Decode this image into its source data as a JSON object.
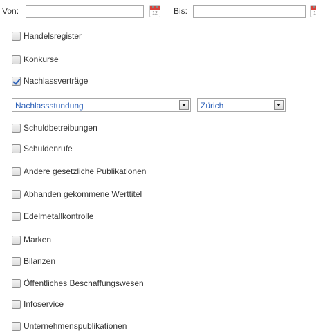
{
  "date_filter": {
    "from_label": "Von:",
    "from_value": "",
    "to_label": "Bis:",
    "to_value": "",
    "calendar_icon_text": "12"
  },
  "categories": [
    {
      "label": "Handelsregister",
      "checked": false
    },
    {
      "label": "Konkurse",
      "checked": false
    },
    {
      "label": "Nachlassverträge",
      "checked": true
    },
    {
      "label": "Schuldbetreibungen",
      "checked": false
    },
    {
      "label": "Schuldenrufe",
      "checked": false
    },
    {
      "label": "Andere gesetzliche Publikationen",
      "checked": false
    },
    {
      "label": "Abhanden gekommene Werttitel",
      "checked": false
    },
    {
      "label": "Edelmetallkontrolle",
      "checked": false
    },
    {
      "label": "Marken",
      "checked": false
    },
    {
      "label": "Bilanzen",
      "checked": false
    },
    {
      "label": "Öffentliches Beschaffungswesen",
      "checked": false
    },
    {
      "label": "Infoservice",
      "checked": false
    },
    {
      "label": "Unternehmenspublikationen",
      "checked": false
    }
  ],
  "subfilters": {
    "type_selected": "Nachlassstundung",
    "canton_selected": "Zürich"
  },
  "colors": {
    "select_text": "#2a5fb8",
    "checkmark": "#2a5fb8",
    "calendar_header": "#d9413a"
  }
}
